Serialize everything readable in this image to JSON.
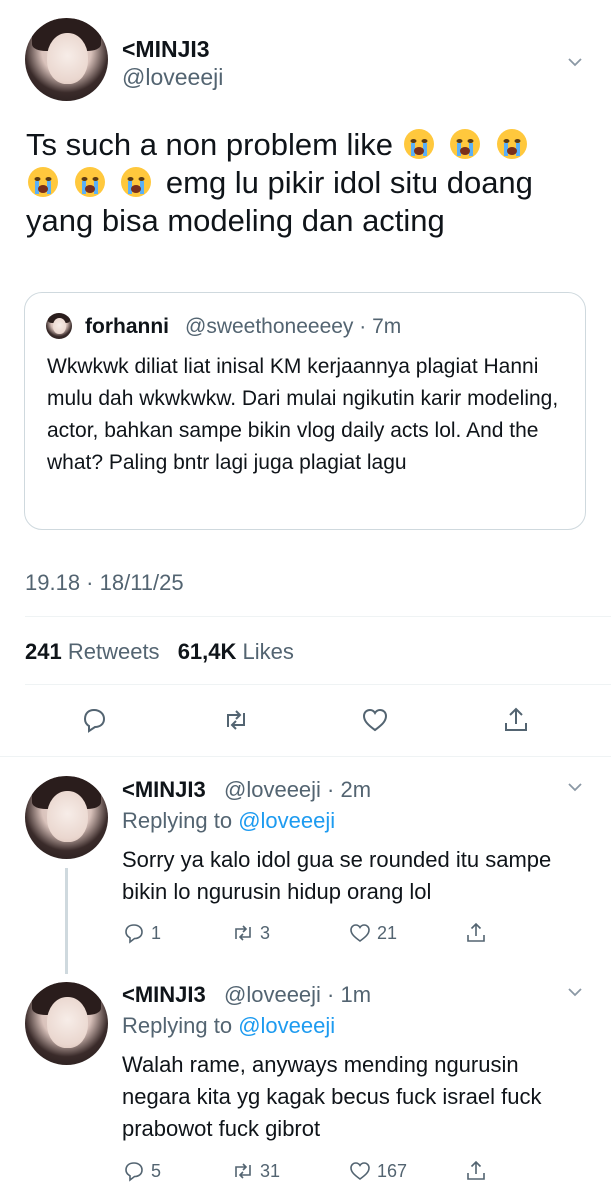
{
  "tweet": {
    "author_name": "<MINJI3",
    "author_handle": "@loveeeji",
    "text_line1": "Ts such a non problem like",
    "text_line2": "emg lu pikir idol situ doang",
    "text_line3": "yang bisa modeling dan acting",
    "emoji": "loudly-crying-face",
    "timestamp": "19.18 · 18/11/25",
    "retweets_count": "241",
    "retweets_label": "Retweets",
    "likes_count": "61,4K",
    "likes_label": "Likes"
  },
  "quote": {
    "author_name": "forhanni",
    "author_handle": "@sweethoneeeey · 7m",
    "text": "Wkwkwk diliat liat inisal KM kerjaannya plagiat Hanni mulu dah wkwkwkw. Dari mulai ngikutin karir modeling, actor, bahkan sampe bikin vlog daily acts lol. And the what? Paling bntr lagi juga plagiat lagu"
  },
  "replies": [
    {
      "author_name": "<MINJI3",
      "author_handle": "@loveeeji · 2m",
      "replying_prefix": "Replying to",
      "replying_to": "@loveeeji",
      "text": "Sorry ya kalo idol gua se rounded itu sampe bikin lo ngurusin hidup orang lol",
      "replies": "1",
      "retweets": "3",
      "likes": "21"
    },
    {
      "author_name": "<MINJI3",
      "author_handle": "@loveeeji · 1m",
      "replying_prefix": "Replying to",
      "replying_to": "@loveeeji",
      "text": "Walah rame, anyways mending ngurusin negara kita yg kagak becus fuck israel fuck prabowot fuck gibrot",
      "replies": "5",
      "retweets": "31",
      "likes": "167"
    }
  ],
  "colors": {
    "text": "#0f1419",
    "secondary": "#536471",
    "link": "#1d9bf0",
    "border": "#cfd9de"
  }
}
